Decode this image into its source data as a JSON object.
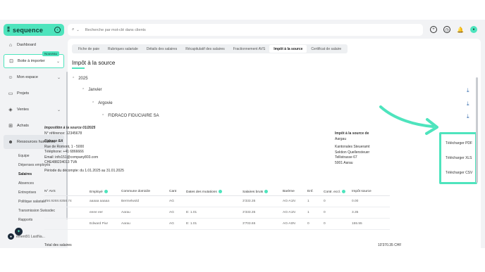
{
  "app": {
    "logo_text": "sequence",
    "logo_mark": "⁑"
  },
  "search": {
    "placeholder": "Recherche par mot-clé dans clients"
  },
  "sidebar": {
    "items": [
      {
        "label": "Dashboard",
        "icon": "home-icon"
      },
      {
        "label": "Boite à importer",
        "icon": "inbox-icon",
        "badge": "Nouveau"
      },
      {
        "label": "Mon espace",
        "icon": "user-icon"
      },
      {
        "label": "Projets",
        "icon": "folder-icon"
      },
      {
        "label": "Ventes",
        "icon": "tag-icon"
      },
      {
        "label": "Achats",
        "icon": "cart-icon"
      },
      {
        "label": "Ressources humaines",
        "icon": "people-icon"
      }
    ],
    "subitems": [
      "Equipe",
      "Dépenses employés",
      "Salaires",
      "Absences",
      "Entreprises",
      "Politique salariale",
      "Transmission Swissdec",
      "Rapports"
    ],
    "user_label": "ement91 LastNa..."
  },
  "tabs": [
    "Fiche de paie",
    "Rubriques salariale",
    "Détails des salaires",
    "Récapitulatif des salaires",
    "Fractionnement AVS",
    "Impôt à la source",
    "Certificat de salaire"
  ],
  "page_title": "Impôt à la source",
  "tree": {
    "year": "2025",
    "month": "Janvier",
    "canton": "Argovie",
    "company": "FIDRACO FIDUCIAIRE SA"
  },
  "info": {
    "heading": "Imposition à la source 01/2025",
    "ref": "N° référence: 12345678",
    "company": "Fidraco SA",
    "street": "Rue de Romont, 1 - 5000",
    "phone": "Téléphone: +41 6866666",
    "email": "Email: info151@company803.com",
    "vat": "CHE488234013 TVA",
    "period": "Période du décompte: du 1.01.2025 au 31.01.2025"
  },
  "info_right": {
    "heading": "Impôt à la source de",
    "line1": "Aargau",
    "line2": "Kantonales Steueramt",
    "line3": "Sektion Quellensteuer",
    "line4": "Telli­strasse 67",
    "line5": "5001 Aarau"
  },
  "table": {
    "headers": [
      "N° AVS",
      "Employé",
      "Commune domicile",
      "Cant",
      "Dates des mutations",
      "Salaires bruts",
      "Barème",
      "Enf.",
      "Contr. eccl.",
      "Impôt source"
    ],
    "rows": [
      [
        "756.9268.8358.74",
        "aaaaa aaaaa",
        "Bermelwold",
        "AG",
        "",
        "3'333.35",
        "AG-A1N",
        "1",
        "0",
        "0.00"
      ],
      [
        "",
        "eeee eer",
        "Aarau",
        "AG",
        "E: 1.01",
        "3'333.35",
        "AG-A1N",
        "1",
        "0",
        "3.35"
      ],
      [
        "",
        "Edward Piur",
        "Aarau",
        "AG",
        "E: 1.01",
        "3'703.65",
        "AG-A0N",
        "0",
        "0",
        "155.55"
      ]
    ],
    "total_label": "Total des salaires",
    "total_value": "10'370.35 CHF"
  },
  "download_menu": [
    "Télécharger PDF",
    "Télécharger XLS",
    "Télécharger CSV"
  ],
  "colors": {
    "accent": "#4ee4bd",
    "link": "#3a6fb0",
    "bell": "#e0534c"
  }
}
